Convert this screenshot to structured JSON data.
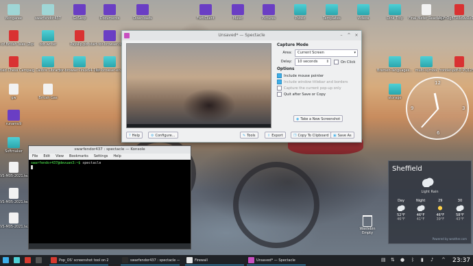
{
  "desktop": {
    "icons": [
      {
        "label": "Bongaree",
        "kind": "home"
      },
      {
        "label": "swarfendor437",
        "kind": "home"
      },
      {
        "label": "GoSkop",
        "kind": "app"
      },
      {
        "label": "Documents",
        "kind": "app"
      },
      {
        "label": "Downloads",
        "kind": "app"
      },
      {
        "label": "FortiClient",
        "kind": "app"
      },
      {
        "label": "Music",
        "kind": "app"
      },
      {
        "label": "Pictures",
        "kind": "app"
      },
      {
        "label": "Public",
        "kind": "folder"
      },
      {
        "label": "Templates",
        "kind": "folder"
      },
      {
        "label": "Videos",
        "kind": "folder"
      },
      {
        "label": "Dink Titly",
        "kind": "folder"
      },
      {
        "label": "Final Meter Readings",
        "kind": "doc"
      },
      {
        "label": "ACFrOgBTR6d9vRx0_PQ1253H...",
        "kind": "pdf"
      },
      {
        "label": "Map of British Isles (Zipscale)",
        "kind": "pdf"
      },
      {
        "label": "odt-writer",
        "kind": "folder"
      },
      {
        "label": "Payslip.pdf",
        "kind": "pdf"
      },
      {
        "label": "start-tor-browser.desktop",
        "kind": "app"
      },
      {
        "label": "Untitled Chess Campaign",
        "kind": "pdf"
      },
      {
        "label": "Calibre Library",
        "kind": "folder"
      },
      {
        "label": "tor-browser-linux64-11.0.4...",
        "kind": "folder"
      },
      {
        "label": "tor-browser-en...",
        "kind": "folder"
      },
      {
        "label": "Bremen-languages...",
        "kind": "folder"
      },
      {
        "label": "multi-symbol",
        "kind": "folder"
      },
      {
        "label": "frontier-pdf-0_PQ1253H...",
        "kind": "pdf"
      },
      {
        "label": "gw",
        "kind": "doc"
      },
      {
        "label": "British Gas",
        "kind": "doc"
      },
      {
        "label": "storage",
        "kind": "folder"
      },
      {
        "label": "runamo9",
        "kind": "app"
      },
      {
        "label": "Softmaker",
        "kind": "folder"
      },
      {
        "label": "AVS-M05-2021.tex",
        "kind": "doc"
      },
      {
        "label": "AVS-M05-2021.tex",
        "kind": "doc"
      },
      {
        "label": "AVS-M05-2021.tex",
        "kind": "doc"
      }
    ],
    "wastebin": "Wastebin Empty"
  },
  "spectacle": {
    "title": "Unsaved* — Spectacle",
    "capture_mode_heading": "Capture Mode",
    "area_label": "Area:",
    "area_value": "Current Screen",
    "delay_label": "Delay:",
    "delay_value": "10 seconds",
    "on_click": "On Click",
    "options_heading": "Options",
    "opt_pointer": "Include mouse pointer",
    "opt_titlebar": "Include window titlebar and borders",
    "opt_popup": "Capture the current pop-up only",
    "opt_quit": "Quit after Save or Copy",
    "take_btn": "Take a New Screenshot",
    "help_btn": "Help",
    "configure_btn": "Configure...",
    "tools_btn": "Tools",
    "export_btn": "Export",
    "copy_btn": "Copy To Clipboard",
    "save_btn": "Save As"
  },
  "konsole": {
    "title": "swarfendor437 : spectacle — Konsole",
    "menu": [
      "File",
      "Edit",
      "View",
      "Bookmarks",
      "Settings",
      "Help"
    ],
    "prompt": "swarfendor437@devuan3:~$",
    "command": "spectacle"
  },
  "clock": {
    "numerals": [
      "12",
      "3",
      "6",
      "9"
    ],
    "time_hour": 23,
    "time_minute": 37
  },
  "weather": {
    "city": "Sheffield",
    "condition": "Light Rain",
    "days": [
      {
        "name": "Day",
        "icon": "cloud",
        "hi": "52°F",
        "lo": "46°F"
      },
      {
        "name": "Night",
        "icon": "cloud",
        "hi": "46°F",
        "lo": "41°F"
      },
      {
        "name": "29",
        "icon": "sun",
        "hi": "46°F",
        "lo": "39°F"
      },
      {
        "name": "30",
        "icon": "cloud",
        "hi": "58°F",
        "lo": "43°F"
      }
    ],
    "source": "Powered by weather.com"
  },
  "taskbar": {
    "tasks": [
      {
        "label": "Pop_OS' screenshot tool on Zorin...",
        "color": "#d53a2f"
      },
      {
        "label": "swarfendor437 : spectacle — Kon...",
        "color": "#2b2b2b"
      },
      {
        "label": "Firewall",
        "color": "#e8e8e8"
      },
      {
        "label": "Unsaved* — Spectacle",
        "color": "#c84fc0"
      }
    ],
    "time": "23:37"
  },
  "colors": {
    "accent": "#3daee9",
    "folder": "#4fd0d6",
    "panel": "#1f2226"
  }
}
